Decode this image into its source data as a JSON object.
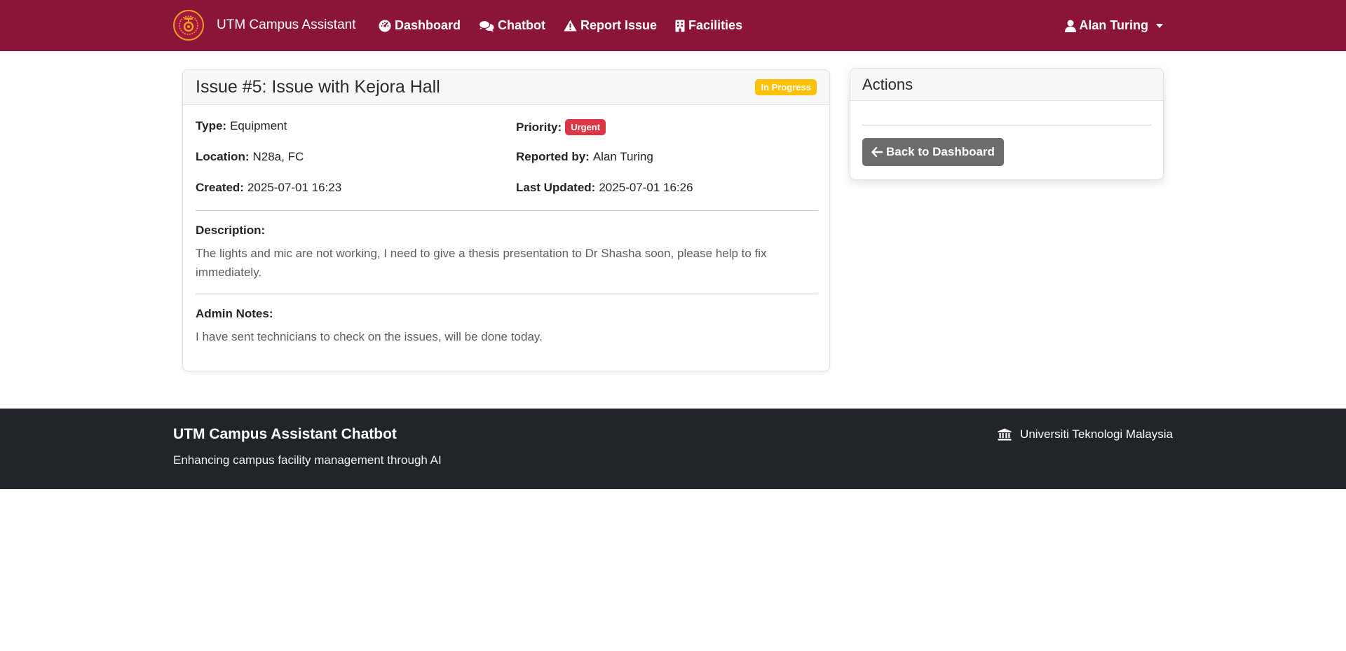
{
  "navbar": {
    "brand": "UTM Campus Assistant",
    "links": [
      {
        "label": "Dashboard",
        "icon": "gauge-icon"
      },
      {
        "label": "Chatbot",
        "icon": "comments-icon"
      },
      {
        "label": "Report Issue",
        "icon": "warning-icon"
      },
      {
        "label": "Facilities",
        "icon": "building-icon"
      }
    ],
    "user": "Alan Turing",
    "bg_color": "#8b1538"
  },
  "issue": {
    "title": "Issue #5: Issue with Kejora Hall",
    "status": "In Progress",
    "status_color": "#ffc107",
    "type_label": "Type:",
    "type": "Equipment",
    "priority_label": "Priority:",
    "priority": "Urgent",
    "priority_color": "#dc3545",
    "location_label": "Location:",
    "location": "N28a, FC",
    "reported_by_label": "Reported by:",
    "reported_by": "Alan Turing",
    "created_label": "Created:",
    "created": "2025-07-01 16:23",
    "updated_label": "Last Updated:",
    "updated": "2025-07-01 16:26",
    "description_label": "Description:",
    "description": "The lights and mic are not working, I need to give a thesis presentation to Dr Shasha soon, please help to fix immediately.",
    "admin_notes_label": "Admin Notes:",
    "admin_notes": "I have sent technicians to check on the issues, will be done today."
  },
  "actions": {
    "title": "Actions",
    "back_label": "Back to Dashboard"
  },
  "footer": {
    "title": "UTM Campus Assistant Chatbot",
    "subtitle": "Enhancing campus facility management through AI",
    "university": "Universiti Teknologi Malaysia",
    "bg_color": "#212529"
  }
}
